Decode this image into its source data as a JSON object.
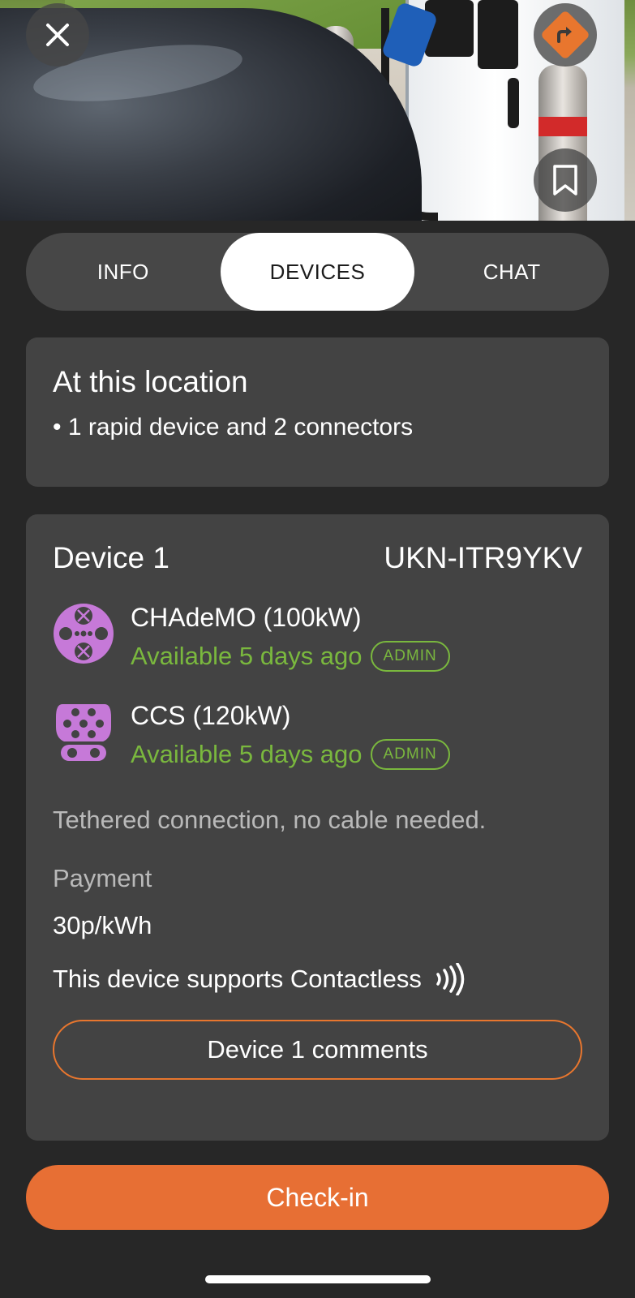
{
  "tabs": [
    {
      "label": "INFO",
      "active": false
    },
    {
      "label": "DEVICES",
      "active": true
    },
    {
      "label": "CHAT",
      "active": false
    }
  ],
  "location": {
    "title": "At this location",
    "summary": "• 1 rapid device and 2 connectors"
  },
  "device": {
    "name": "Device 1",
    "id": "UKN-ITR9YKV",
    "connectors": [
      {
        "name": "CHAdeMO (100kW)",
        "status": "Available 5 days ago",
        "badge": "ADMIN",
        "icon": "chademo-connector-icon"
      },
      {
        "name": "CCS (120kW)",
        "status": "Available 5 days ago",
        "badge": "ADMIN",
        "icon": "ccs-connector-icon"
      }
    ],
    "tether_note": "Tethered connection, no cable needed.",
    "payment_label": "Payment",
    "payment_value": "30p/kWh",
    "contactless": "This device supports Contactless",
    "comments_label": "Device 1 comments"
  },
  "checkin_label": "Check-in",
  "colors": {
    "accent": "#e76f34",
    "available": "#7ab83e",
    "connector": "#c679d8",
    "card": "#434343",
    "background": "#272727"
  }
}
